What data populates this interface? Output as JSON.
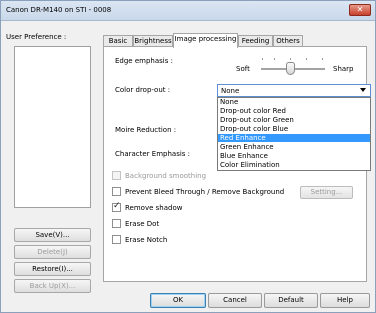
{
  "window": {
    "title": "Canon DR-M140 on STI - 0008",
    "close_glyph": "✕"
  },
  "left": {
    "user_preference_label": "User Preference :",
    "buttons": [
      {
        "label": "Save(V)...",
        "enabled": true
      },
      {
        "label": "Delete(J)",
        "enabled": false
      },
      {
        "label": "Restore(I)...",
        "enabled": true
      },
      {
        "label": "Back Up(X)...",
        "enabled": false
      }
    ]
  },
  "tabs": [
    {
      "label": "Basic",
      "active": false
    },
    {
      "label": "Brightness",
      "active": false
    },
    {
      "label": "Image processing",
      "active": true
    },
    {
      "label": "Feeding",
      "active": false
    },
    {
      "label": "Others",
      "active": false
    }
  ],
  "image_processing": {
    "edge_emphasis": {
      "label": "Edge emphasis :",
      "min_label": "Soft",
      "max_label": "Sharp"
    },
    "color_dropout": {
      "label": "Color drop-out :",
      "value": "None",
      "options": [
        "None",
        "Drop-out color Red",
        "Drop-out color Green",
        "Drop-out color Blue",
        "Red Enhance",
        "Green Enhance",
        "Blue Enhance",
        "Color Elimination"
      ],
      "highlighted_index": 4
    },
    "moire_label": "Moire Reduction :",
    "character_emphasis_label": "Character Emphasis :",
    "checkboxes": [
      {
        "label": "Background smoothing",
        "checked": false,
        "enabled": false
      },
      {
        "label": "Prevent Bleed Through / Remove Background",
        "checked": false,
        "enabled": true
      },
      {
        "label": "Remove shadow",
        "checked": true,
        "enabled": true
      },
      {
        "label": "Erase Dot",
        "checked": false,
        "enabled": true
      },
      {
        "label": "Erase Notch",
        "checked": false,
        "enabled": true
      }
    ],
    "setting_button": "Setting..."
  },
  "footer": {
    "ok": "OK",
    "cancel": "Cancel",
    "default": "Default",
    "help": "Help"
  }
}
